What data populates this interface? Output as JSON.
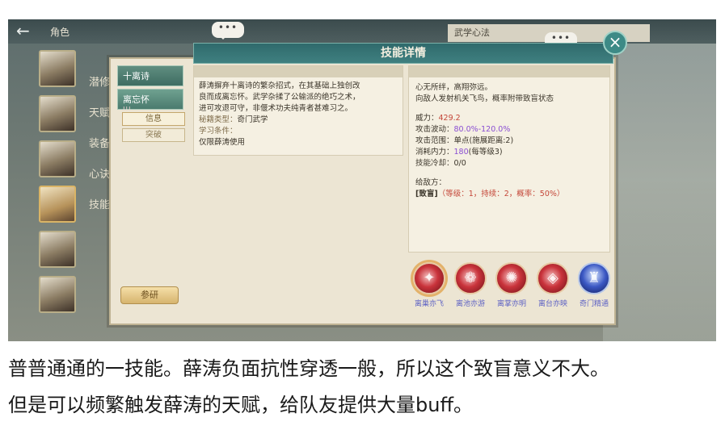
{
  "topbar": {
    "role_label": "角色",
    "wuxue_label": "武学心法",
    "chat_bubble": "•••"
  },
  "side_menu": [
    "潜修",
    "天赋",
    "装备",
    "心诀",
    "技能"
  ],
  "modal": {
    "title": "技能详情",
    "close_icon": "×",
    "tabs": {
      "skill1": "十离诗",
      "skill2": "离忘怀",
      "skill2_marks": "ııı",
      "info": "信息",
      "breakthrough": "突破"
    },
    "research_button": "参研",
    "description": {
      "lines": [
        "薛涛摒弃十离诗的繁杂招式，在其基础上独创改",
        "良而成离忘怀。武学杂揉了公输派的绝巧之术，",
        "进可攻退可守，非偃术功夫纯青者甚难习之。"
      ],
      "type_label": "秘籍类型：",
      "type_value": "奇门武学",
      "condition_label": "学习条件：",
      "condition_value": "仅限薛涛使用"
    },
    "stats": {
      "flavor1": "心无所绊，高翔弥远。",
      "flavor2": "向敌人发射机关飞鸟，概率附带致盲状态",
      "power_label": "威力：",
      "power_value": "429.2",
      "fluct_label": "攻击波动：",
      "fluct_value": "80.0%-120.0%",
      "range_label": "攻击范围：",
      "range_value": "单点(施展距离:2)",
      "cost_label": "消耗内力：",
      "cost_value": "180",
      "cost_suffix": "(每等级3)",
      "cd_label": "技能冷却：",
      "cd_value": "0/0",
      "enemy_label": "给敌方：",
      "status_tag": "[致盲]",
      "status_effect": "（等级：1，持续：2，概率：50%）"
    },
    "skills": [
      {
        "name": "离巢亦飞",
        "icon": "bird-feather-icon"
      },
      {
        "name": "离池亦游",
        "icon": "fish-icon"
      },
      {
        "name": "离掌亦明",
        "icon": "pearl-icon"
      },
      {
        "name": "离台亦映",
        "icon": "mirror-icon"
      },
      {
        "name": "奇门精通",
        "icon": "mechanism-icon"
      }
    ]
  },
  "caption": {
    "line1": "普普通通的一技能。薛涛负面抗性穿透一般，所以这个致盲意义不大。",
    "line2": "但是可以频繁触发薛涛的天赋，给队友提供大量buff。"
  }
}
